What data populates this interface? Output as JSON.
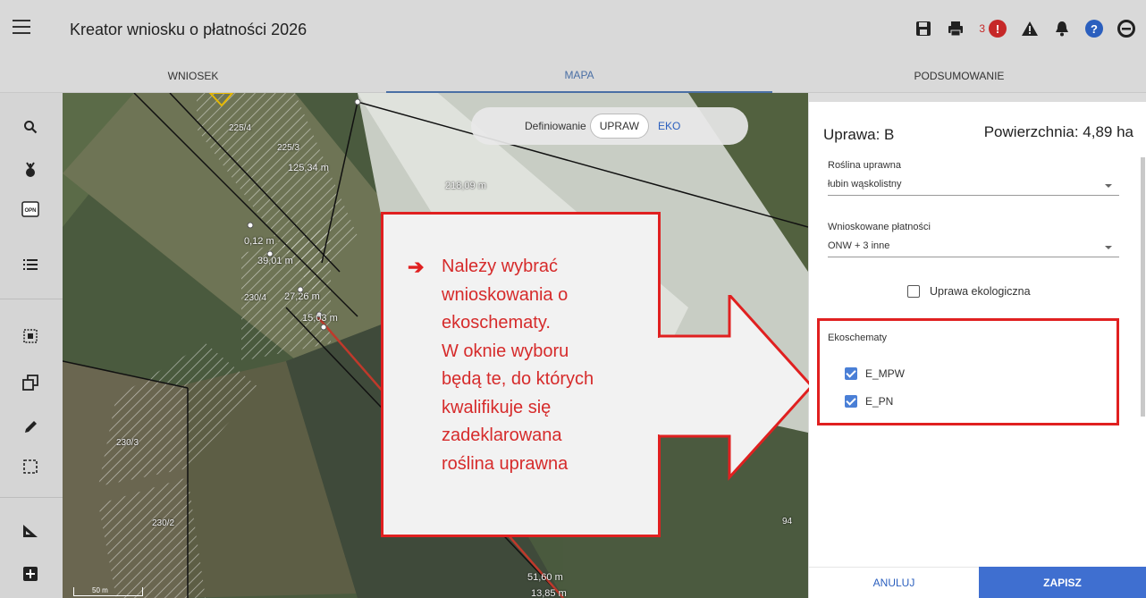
{
  "app": {
    "title": "Kreator wniosku o płatności 2026"
  },
  "header": {
    "alert_count": "3",
    "alert_symbol": "!",
    "help_symbol": "?"
  },
  "tabs": [
    {
      "label": "WNIOSEK"
    },
    {
      "label": "MAPA"
    },
    {
      "label": "PODSUMOWANIE"
    }
  ],
  "toolbar": {
    "opn_label": "OPN"
  },
  "map": {
    "mode": {
      "label": "Definiowanie",
      "options": [
        "UPRAW",
        "EKO"
      ],
      "selected": "UPRAW"
    },
    "parcels": [
      "225/4",
      "225/3",
      "230/4",
      "230/3",
      "230/2",
      "94"
    ],
    "distances": [
      "125,34 m",
      "218,09 m",
      "0,12 m",
      "39,01 m",
      "27,26 m",
      "15,03 m",
      "51,60 m",
      "13,85 m"
    ],
    "scale": "50 m"
  },
  "callout": {
    "lines": [
      "Należy wybrać",
      "wnioskowania o",
      "ekoschematy.",
      "W oknie wyboru",
      "będą te, do których",
      "kwalifikuje się",
      "zadeklarowana",
      "roślina uprawna"
    ]
  },
  "panel": {
    "title": "Uprawa: B",
    "area": "Powierzchnia: 4,89 ha",
    "crop": {
      "label": "Roślina uprawna",
      "value": "łubin wąskolistny"
    },
    "payments": {
      "label": "Wnioskowane płatności",
      "value": "ONW + 3 inne"
    },
    "organic": {
      "label": "Uprawa ekologiczna",
      "checked": false
    },
    "ecoschemes": {
      "label": "Ekoschematy",
      "items": [
        {
          "label": "E_MPW",
          "checked": true
        },
        {
          "label": "E_PN",
          "checked": true
        }
      ]
    },
    "cancel_label": "ANULUJ",
    "save_label": "ZAPISZ"
  },
  "colors": {
    "accent": "#4a6fa5",
    "highlight": "#e02020",
    "save": "#3f6fd0",
    "callout_text": "#d62b2b"
  }
}
